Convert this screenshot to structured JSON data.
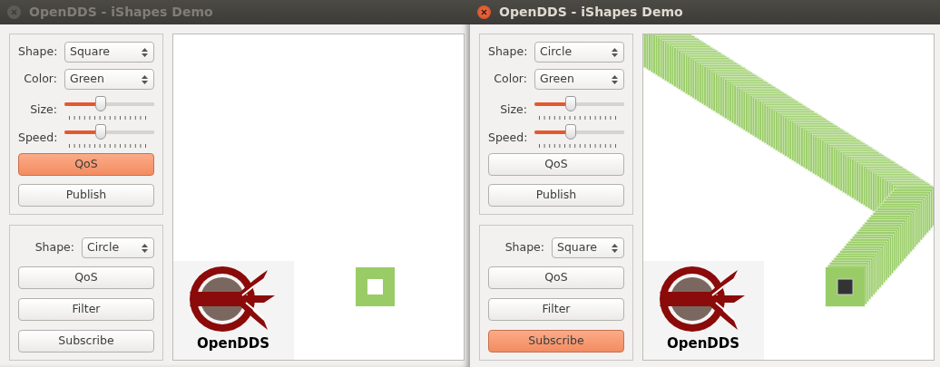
{
  "windows": [
    {
      "title": "OpenDDS - iShapes Demo",
      "active": false,
      "publisher": {
        "fields": [
          {
            "kind": "select",
            "label": "Shape:",
            "value": "Square"
          },
          {
            "kind": "select",
            "label": "Color:",
            "value": "Green"
          },
          {
            "kind": "slider",
            "label": "Size:",
            "level": 0.4
          },
          {
            "kind": "slider",
            "label": "Speed:",
            "level": 0.4
          }
        ],
        "buttons": [
          {
            "label": "QoS",
            "highlighted": true
          },
          {
            "label": "Publish",
            "highlighted": false
          }
        ]
      },
      "subscriber": {
        "field": {
          "label": "Shape:",
          "value": "Circle"
        },
        "buttons": [
          {
            "label": "QoS",
            "highlighted": false
          },
          {
            "label": "Filter",
            "highlighted": false
          },
          {
            "label": "Subscribe",
            "highlighted": false
          }
        ]
      },
      "logo": "OpenDDS",
      "canvas": {
        "kind": "single"
      }
    },
    {
      "title": "OpenDDS - iShapes Demo",
      "active": true,
      "publisher": {
        "fields": [
          {
            "kind": "select",
            "label": "Shape:",
            "value": "Circle"
          },
          {
            "kind": "select",
            "label": "Color:",
            "value": "Green"
          },
          {
            "kind": "slider",
            "label": "Size:",
            "level": 0.4
          },
          {
            "kind": "slider",
            "label": "Speed:",
            "level": 0.4
          }
        ],
        "buttons": [
          {
            "label": "QoS",
            "highlighted": false
          },
          {
            "label": "Publish",
            "highlighted": false
          }
        ]
      },
      "subscriber": {
        "field": {
          "label": "Shape:",
          "value": "Square"
        },
        "buttons": [
          {
            "label": "QoS",
            "highlighted": false
          },
          {
            "label": "Filter",
            "highlighted": false
          },
          {
            "label": "Subscribe",
            "highlighted": true
          }
        ]
      },
      "logo": "OpenDDS",
      "canvas": {
        "kind": "trail"
      }
    }
  ]
}
